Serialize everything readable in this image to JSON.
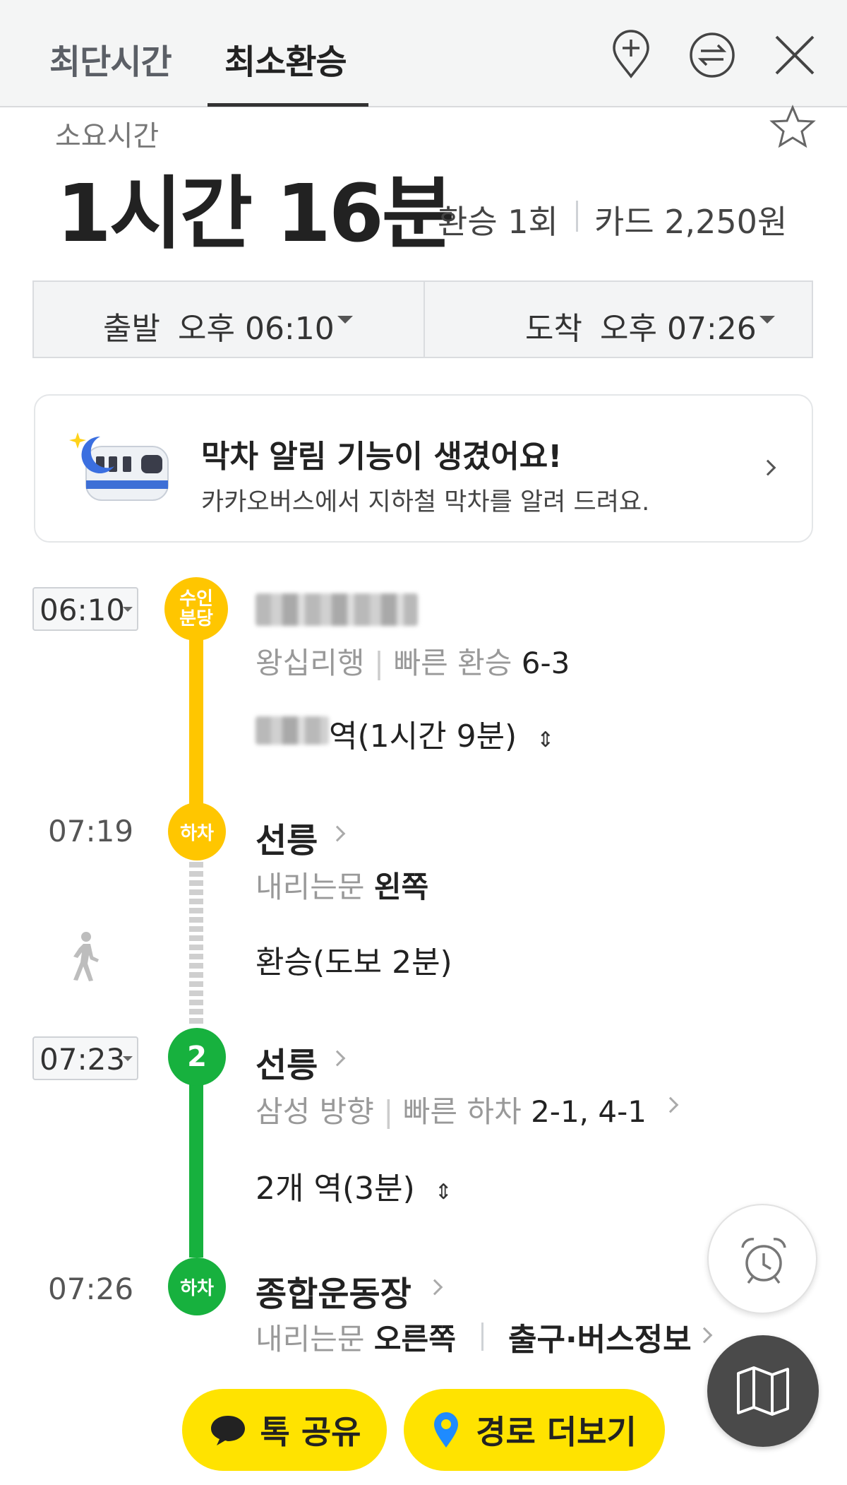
{
  "tabs": [
    {
      "label": "최단시간",
      "active": false
    },
    {
      "label": "최소환승",
      "active": true
    }
  ],
  "header_icons": [
    "add-location-icon",
    "swap-icon",
    "close-icon"
  ],
  "summary": {
    "duration_label": "소요시간",
    "duration": "1시간 16분",
    "transfers": "환승 1회",
    "fare": "카드 2,250원"
  },
  "times": {
    "depart_label": "출발",
    "depart_time": "오후 06:10",
    "arrive_label": "도착",
    "arrive_time": "오후 07:26"
  },
  "banner": {
    "title": "막차 알림 기능이 생겼어요!",
    "subtitle": "카카오버스에서 지하철 막차를 알려 드려요."
  },
  "route": {
    "leg1": {
      "time": "06:10",
      "line_badge": "수인\n분당",
      "direction": "왕십리행",
      "fast_transfer_label": "빠른 환승",
      "fast_transfer_value": "6-3",
      "stops_text": "역(1시간 9분)",
      "color": "#ffc600"
    },
    "alight1": {
      "time": "07:19",
      "badge": "하차",
      "station": "선릉",
      "door_label": "내리는문",
      "door_value": "왼쪽"
    },
    "walk": {
      "text": "환승(도보 2분)"
    },
    "leg2": {
      "time": "07:23",
      "line_badge": "2",
      "station": "선릉",
      "direction": "삼성 방향",
      "fast_exit_label": "빠른 하차",
      "fast_exit_value": "2-1, 4-1",
      "stops_text": "2개 역(3분)",
      "color": "#17b13e"
    },
    "alight2": {
      "time": "07:26",
      "badge": "하차",
      "station": "종합운동장",
      "door_label": "내리는문",
      "door_value": "오른쪽",
      "exit_info": "출구·버스정보"
    }
  },
  "actions": {
    "share_label": "톡 공유",
    "more_routes_label": "경로 더보기"
  },
  "colors": {
    "accent_yellow": "#ffe300",
    "line_suin": "#ffc600",
    "line_2": "#17b13e",
    "fab_dark": "#4a4a4a"
  }
}
